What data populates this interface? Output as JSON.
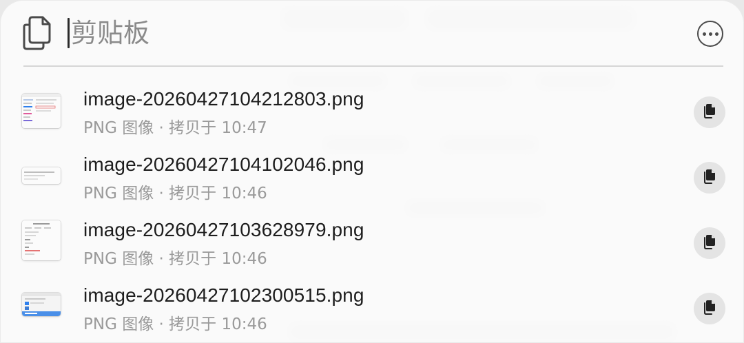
{
  "header": {
    "placeholder": "剪贴板",
    "clipboard_icon": "clipboard-copy-icon",
    "more_icon": "ellipsis-circle-icon"
  },
  "items": [
    {
      "filename": "image-20260427104212803.png",
      "subtitle": "PNG 图像 · 拷贝于 10:47",
      "thumbnail": "screenshot-thumbnail-sidebar"
    },
    {
      "filename": "image-20260427104102046.png",
      "subtitle": "PNG 图像 · 拷贝于 10:46",
      "thumbnail": "screenshot-thumbnail-banner"
    },
    {
      "filename": "image-20260427103628979.png",
      "subtitle": "PNG 图像 · 拷贝于 10:46",
      "thumbnail": "screenshot-thumbnail-document"
    },
    {
      "filename": "image-20260427102300515.png",
      "subtitle": "PNG 图像 · 拷贝于 10:46",
      "thumbnail": "screenshot-thumbnail-dialog"
    }
  ],
  "colors": {
    "accent": "#2f80ed",
    "text": "#1d1d1d",
    "muted": "#9a9a9a"
  }
}
